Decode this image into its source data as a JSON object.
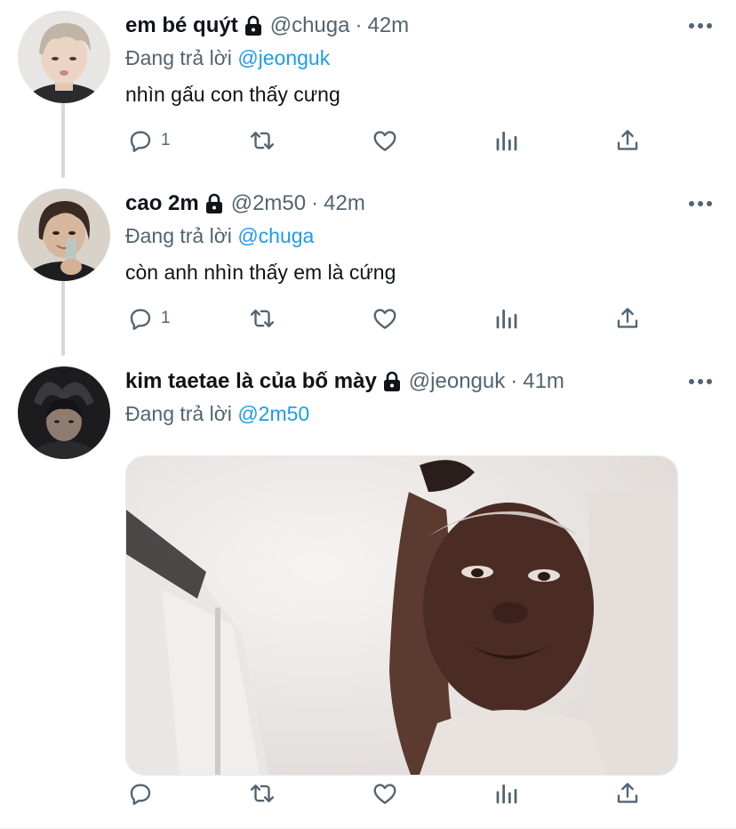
{
  "tweets": [
    {
      "name": "em bé quýt",
      "handle": "@chuga",
      "separator": "·",
      "time": "42m",
      "reply_prefix": "Đang trả lời",
      "reply_to": "@jeonguk",
      "text": "nhìn gấu con thấy cưng",
      "reply_count": "1"
    },
    {
      "name": "cao 2m",
      "handle": "@2m50",
      "separator": "·",
      "time": "42m",
      "reply_prefix": "Đang trả lời",
      "reply_to": "@chuga",
      "text": "còn anh nhìn thấy em là cứng",
      "reply_count": "1"
    },
    {
      "name": "kim taetae là của bố mày",
      "handle": "@jeonguk",
      "separator": "·",
      "time": "41m",
      "reply_prefix": "Đang trả lời",
      "reply_to": "@2m50",
      "reply_count": ""
    }
  ],
  "icons": {
    "reply": "reply-icon",
    "retweet": "retweet-icon",
    "like": "heart-icon",
    "views": "analytics-icon",
    "share": "share-icon",
    "more": "more-icon",
    "lock": "lock-icon"
  },
  "colors": {
    "text": "#0f1419",
    "secondary": "#536471",
    "link": "#1d9bf0",
    "thread_line": "#cfd9de"
  }
}
